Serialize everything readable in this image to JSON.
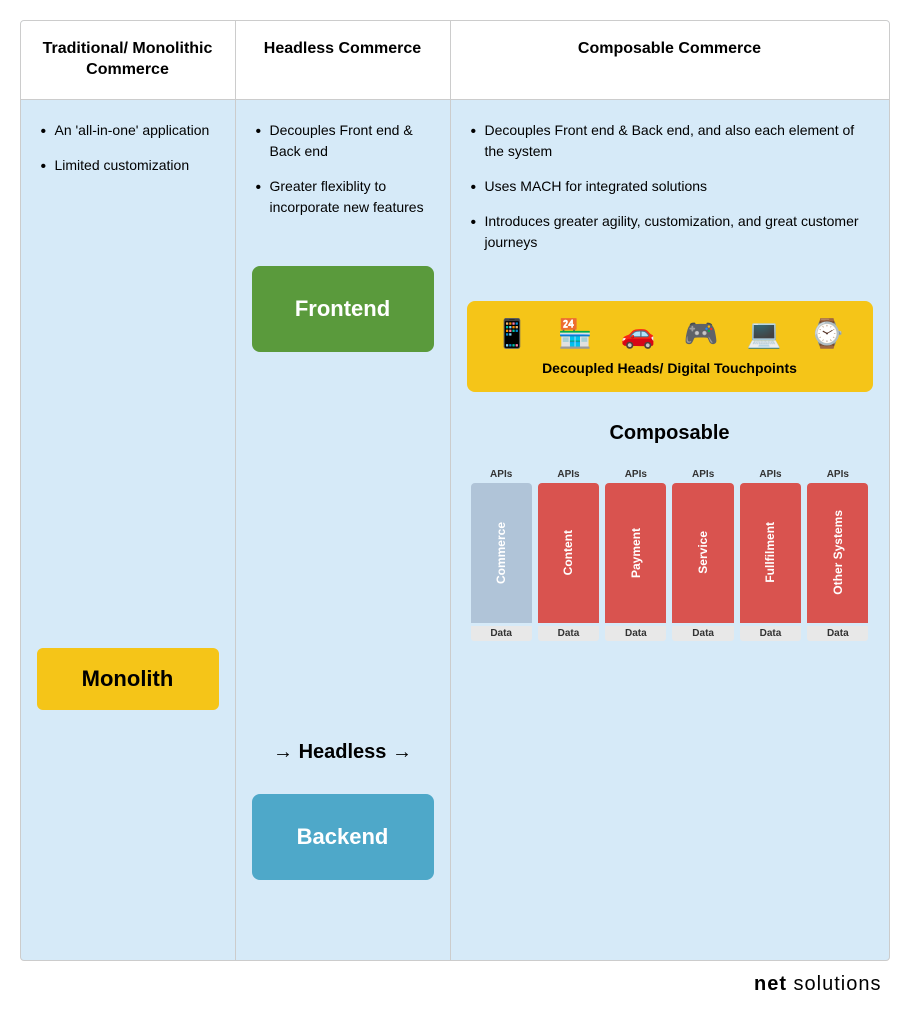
{
  "header": {
    "col1": "Traditional/ Monolithic Commerce",
    "col2": "Headless Commerce",
    "col3": "Composable Commerce"
  },
  "col1": {
    "bullets": [
      "An 'all-in-one' application",
      "Limited customization"
    ],
    "monolith_label": "Monolith"
  },
  "col2": {
    "bullets": [
      "Decouples Front end &  Back end",
      "Greater flexiblity to incorporate new features"
    ],
    "frontend_label": "Frontend",
    "backend_label": "Backend",
    "headless_label": "Headless"
  },
  "col3": {
    "bullets": [
      "Decouples Front end &  Back end, and also each element of the system",
      "Uses MACH for integrated solutions",
      "Introduces greater agility, customization, and great customer journeys"
    ],
    "touchpoints_label": "Decoupled Heads/ Digital Touchpoints",
    "composable_label": "Composable",
    "bars": [
      {
        "api": "APIs",
        "label": "Commerce",
        "color": "#b0c4d8",
        "data": "Data"
      },
      {
        "api": "APIs",
        "label": "Content",
        "color": "#d9534f",
        "data": "Data"
      },
      {
        "api": "APIs",
        "label": "Payment",
        "color": "#d9534f",
        "data": "Data"
      },
      {
        "api": "APIs",
        "label": "Service",
        "color": "#d9534f",
        "data": "Data"
      },
      {
        "api": "APIs",
        "label": "Fullfilment",
        "color": "#d9534f",
        "data": "Data"
      },
      {
        "api": "APIs",
        "label": "Other Systems",
        "color": "#d9534f",
        "data": "Data"
      }
    ]
  },
  "footer": {
    "brand": "net solutions"
  },
  "icons": {
    "phone": "📱",
    "store": "🏪",
    "car": "🚗",
    "gamepad": "🎮",
    "laptop": "💻",
    "watch": "⌚"
  },
  "arrows": {
    "right": "→"
  }
}
